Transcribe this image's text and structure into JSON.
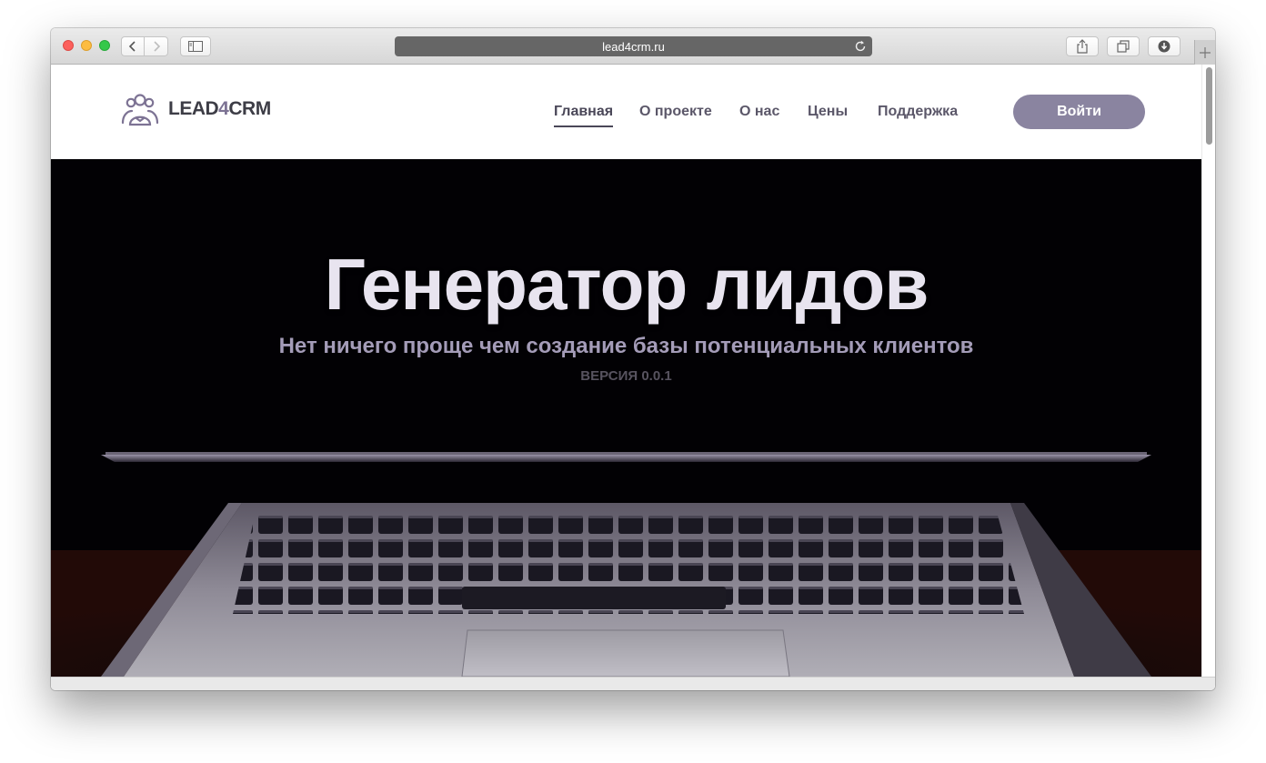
{
  "browser": {
    "url": "lead4crm.ru",
    "icons": {
      "back": "chevron-left-icon",
      "forward": "chevron-right-icon",
      "sidebar": "sidebar-icon",
      "reload": "reload-icon",
      "share": "share-icon",
      "tabs": "tabs-overview-icon",
      "downloads": "download-icon",
      "new_tab": "plus-icon"
    }
  },
  "site": {
    "logo": {
      "text_start": "LEAD",
      "text_accent": "4",
      "text_end": "CRM",
      "icon": "people-group-icon"
    },
    "nav": [
      {
        "label": "Главная",
        "active": true
      },
      {
        "label": "О проекте",
        "active": false
      },
      {
        "label": "О нас",
        "active": false
      },
      {
        "label": "Цены",
        "active": false
      },
      {
        "label": "Поддержка",
        "active": false
      }
    ],
    "login_label": "Войти"
  },
  "hero": {
    "title": "Генератор лидов",
    "subtitle": "Нет ничего проще чем создание базы потенциальных клиентов",
    "version": "ВЕРСИЯ 0.0.1",
    "background": "laptop-keyboard-image"
  },
  "colors": {
    "accent": "#8a84a0",
    "logo_accent": "#7d7394",
    "nav_text": "#5b5769",
    "hero_bg": "#020104",
    "hero_title": "#e8e4ef",
    "hero_subtitle": "#a49cb8",
    "url_bar": "#666666"
  }
}
